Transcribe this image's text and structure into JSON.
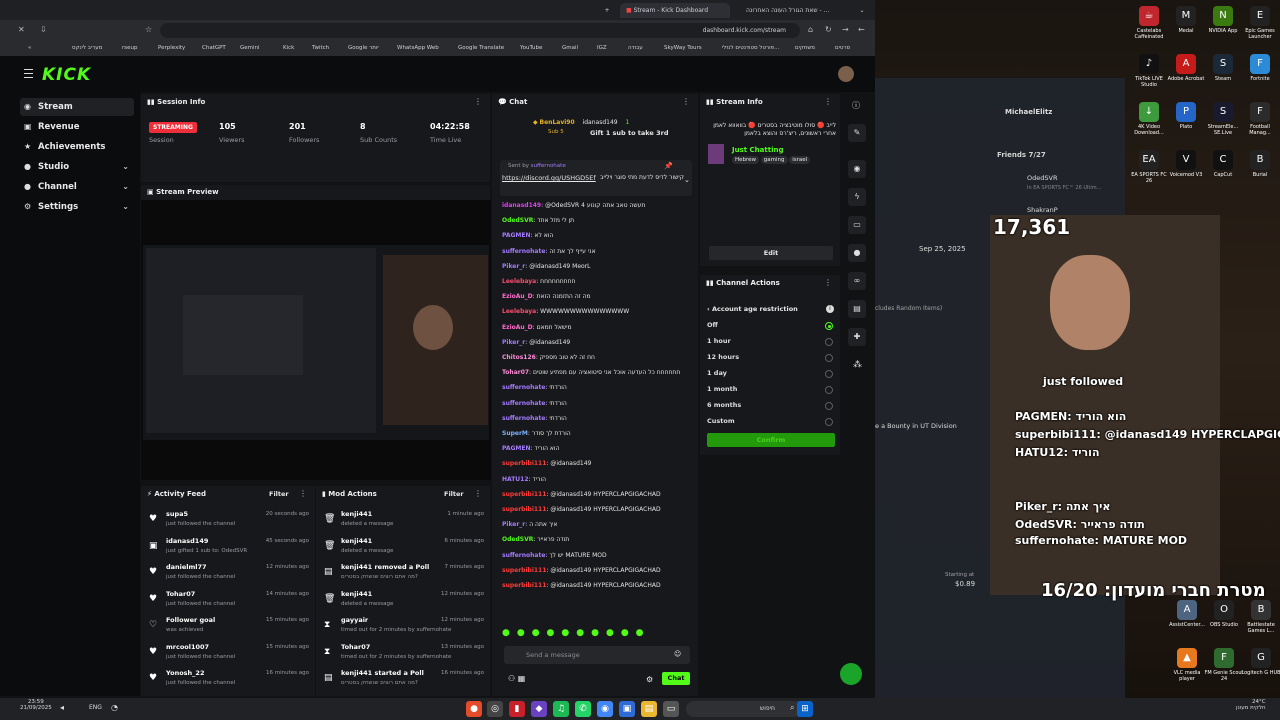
{
  "browser": {
    "tabs": [
      "Stream - Kick Dashboard",
      "שאת הגורל העונה האחרונה - ..."
    ],
    "url": "dashboard.kick.com/stream",
    "bookmarks": [
      "rseup",
      "Perplexity",
      "ChatGPT",
      "Gemini",
      "Kick",
      "Twitch",
      "Google יותר",
      "WhatsApp Web",
      "Google Translate",
      "YouTube",
      "Gmail",
      "IGZ",
      "עבודה",
      "SkyWay Tours",
      "פורטל סטודנטים לנזלי...",
      "משחקים",
      "סרטים"
    ],
    "bookmark_left": "מעריב לינקס"
  },
  "sidebar": {
    "items": [
      {
        "label": "Stream",
        "icon": "broadcast-icon",
        "active": true
      },
      {
        "label": "Revenue",
        "icon": "revenue-icon"
      },
      {
        "label": "Achievements",
        "icon": "achievements-icon"
      },
      {
        "label": "Studio",
        "icon": "studio-icon",
        "chev": "⌄"
      },
      {
        "label": "Channel",
        "icon": "channel-icon",
        "chev": "⌄"
      },
      {
        "label": "Settings",
        "icon": "settings-icon",
        "chev": "⌄"
      }
    ]
  },
  "session": {
    "title": "Session Info",
    "status": "STREAMING",
    "status_label": "Session",
    "stats": [
      {
        "value": "105",
        "label": "Viewers"
      },
      {
        "value": "201",
        "label": "Followers"
      },
      {
        "value": "8",
        "label": "Sub Counts"
      },
      {
        "value": "04:22:58",
        "label": "Time Live"
      }
    ]
  },
  "preview": {
    "title": "Stream Preview"
  },
  "activity": {
    "title": "Activity Feed",
    "filter": "Filter",
    "rows": [
      {
        "name": "supa5",
        "desc": "just followed the channel",
        "time": "20 seconds ago",
        "icon": "heart-icon"
      },
      {
        "name": "idanasd149",
        "desc": "just gifted 1 sub to: OdedSVR",
        "time": "45 seconds ago",
        "icon": "gift-icon"
      },
      {
        "name": "danielml77",
        "desc": "just followed the channel",
        "time": "12 minutes ago",
        "icon": "heart-icon"
      },
      {
        "name": "Tohar07",
        "desc": "just followed the channel",
        "time": "14 minutes ago",
        "icon": "heart-icon"
      },
      {
        "name": "Follower goal",
        "desc": "was achieved",
        "time": "15 minutes ago",
        "icon": "heart-outline-icon"
      },
      {
        "name": "mrcool1007",
        "desc": "just followed the channel",
        "time": "15 minutes ago",
        "icon": "heart-icon"
      },
      {
        "name": "Yonosh_22",
        "desc": "just followed the channel",
        "time": "16 minutes ago",
        "icon": "heart-icon"
      }
    ]
  },
  "mod": {
    "title": "Mod Actions",
    "filter": "Filter",
    "rows": [
      {
        "name": "kenji441",
        "desc": "deleted a message",
        "time": "1 minute ago",
        "icon": "trash-icon"
      },
      {
        "name": "kenji441",
        "desc": "deleted a message",
        "time": "6 minutes ago",
        "icon": "trash-icon"
      },
      {
        "name": "kenji441 removed a Poll",
        "desc": "מה אתם רוצים שנשחק בסטרים?",
        "time": "7 minutes ago",
        "icon": "poll-icon"
      },
      {
        "name": "kenji441",
        "desc": "deleted a message",
        "time": "12 minutes ago",
        "icon": "trash-icon"
      },
      {
        "name": "gayyair",
        "desc": "timed out for 2 minutes by suffernohate",
        "time": "12 minutes ago",
        "icon": "hourglass-icon"
      },
      {
        "name": "Tohar07",
        "desc": "timed out for 2 minutes by suffernohate",
        "time": "13 minutes ago",
        "icon": "hourglass-icon"
      },
      {
        "name": "kenji441 started a Poll",
        "desc": "מה אתם רוצים שנשחק בסטרים?",
        "time": "16 minutes ago",
        "icon": "poll-icon"
      }
    ]
  },
  "chat": {
    "title": "Chat",
    "gift_user": "BenLavi90",
    "gift_sub": "Sub 5",
    "gift_to": "idanasd149",
    "gift_count": "1",
    "gift_text": "Gift 1 sub to take 3rd",
    "pinned_by": "Sent by",
    "pinned_user": "suffernohate",
    "pinned_link": "https://discord.gg/USHGD5Ef",
    "pinned_text": "קישור לדיס לדעת מתי סוגר וילייב",
    "messages": [
      {
        "user": "idanasd149",
        "text": "@OdedSVR 4 תעשה טאב אתה קונוע",
        "color": "#e13ff2"
      },
      {
        "user": "OdedSVR",
        "text": "תן לי מזל אחד",
        "color": "#53fc18"
      },
      {
        "user": "PAGMEN",
        "text": "הוא לא",
        "color": "#a47cff"
      },
      {
        "user": "suffernohate",
        "text": "אני עייף לך את זה",
        "color": "#a47cff"
      },
      {
        "user": "Piker_r",
        "text": "@idanasd149 MeorL",
        "color": "#a47cff"
      },
      {
        "user": "Leelebaya",
        "text": "חחחחחחחחח",
        "color": "#ff4b6e"
      },
      {
        "user": "EzioAu_D",
        "text": "מה זה התזמנה הזאת",
        "color": "#ff6bcf"
      },
      {
        "user": "Leelebaya",
        "text": "WWWWWWWWWWWWWWW",
        "color": "#ff4b6e"
      },
      {
        "user": "EzioAu_D",
        "text": "מישאל חמאם",
        "color": "#ff6bcf"
      },
      {
        "user": "Piker_r",
        "text": "@idanasd149",
        "color": "#a47cff"
      },
      {
        "user": "Chitos126",
        "text": "חח זה לא טוב מספיק",
        "color": "#ff8ad8"
      },
      {
        "user": "Tohar07",
        "text": "חחחחחח כל העדעה אוכל אני סיטואציה עם מפתיע שוטים",
        "color": "#ff8ad8"
      },
      {
        "user": "suffernohate",
        "text": "הורדתי",
        "color": "#a47cff"
      },
      {
        "user": "suffernohate",
        "text": "הורדתי",
        "color": "#a47cff"
      },
      {
        "user": "suffernohate",
        "text": "הורדתי",
        "color": "#a47cff"
      },
      {
        "user": "SuperM",
        "text": "הורדת לך סודר",
        "color": "#7ab1ff"
      },
      {
        "user": "PAGMEN",
        "text": "הוא הוריד",
        "color": "#a47cff"
      },
      {
        "user": "superbibi111",
        "text": "@idanasd149",
        "color": "#ff3b3b"
      },
      {
        "user": "HATU12",
        "text": "הוריד",
        "color": "#a47cff"
      },
      {
        "user": "superbibi111",
        "text": "@idanasd149 HYPERCLAPGIGACHAD",
        "color": "#ff3b3b"
      },
      {
        "user": "superbibi111",
        "text": "@idanasd149 HYPERCLAPGIGACHAD",
        "color": "#ff3b3b"
      },
      {
        "user": "Piker_r",
        "text": "איך אתה ה",
        "color": "#a47cff"
      },
      {
        "user": "OdedSVR",
        "text": "תודה פראייר",
        "color": "#53fc18"
      },
      {
        "user": "suffernohate",
        "text": "יש לך MATURE MOD",
        "color": "#a47cff"
      },
      {
        "user": "superbibi111",
        "text": "@idanasd149 HYPERCLAPGIGACHAD",
        "color": "#ff3b3b"
      },
      {
        "user": "superbibi111",
        "text": "@idanasd149 HYPERCLAPGIGACHAD",
        "color": "#ff3b3b"
      }
    ],
    "input_placeholder": "Send a message",
    "send_label": "Chat"
  },
  "stream_info": {
    "title": "Stream Info",
    "stream_title": "לייב 🔴 סולו מוטיבציה בסטרים 🔴 בוואווא לאמן אחרי ראשונים, ריצ'רס והוצא בלאמן",
    "category": "Just Chatting",
    "tags": [
      "Hebrew",
      "gaming",
      "israel"
    ],
    "edit": "Edit"
  },
  "channel_actions": {
    "title": "Channel Actions",
    "back_label": "Account age restriction",
    "options": [
      "Off",
      "1 hour",
      "12 hours",
      "1 day",
      "1 month",
      "6 months",
      "Custom"
    ],
    "selected": 0,
    "confirm": "Confirm"
  },
  "desktop": {
    "icons": [
      {
        "label": "Castelabs Caffeinated",
        "color": "#c0262d",
        "glyph": "☕"
      },
      {
        "label": "Medal",
        "color": "#222",
        "glyph": "M"
      },
      {
        "label": "NVIDIA App",
        "color": "#3a7a10",
        "glyph": "N"
      },
      {
        "label": "Epic Games Launcher",
        "color": "#222",
        "glyph": "E"
      },
      {
        "label": "TikTok LIVE Studio",
        "color": "#111",
        "glyph": "♪"
      },
      {
        "label": "Adobe Acrobat",
        "color": "#c51b1b",
        "glyph": "A"
      },
      {
        "label": "Steam",
        "color": "#1b2838",
        "glyph": "S"
      },
      {
        "label": "Fortnite",
        "color": "#2b8bd6",
        "glyph": "F"
      },
      {
        "label": "4K Video Download...",
        "color": "#3d9b3d",
        "glyph": "↓"
      },
      {
        "label": "Plato",
        "color": "#2565c7",
        "glyph": "P"
      },
      {
        "label": "StreamEle... SE.Live",
        "color": "#1a1a2e",
        "glyph": "S"
      },
      {
        "label": "Football Manag...",
        "color": "#2b2b2b",
        "glyph": "F"
      },
      {
        "label": "EA SPORTS FC 26",
        "color": "#222",
        "glyph": "EA"
      },
      {
        "label": "Voicemod V3",
        "color": "#111",
        "glyph": "V"
      },
      {
        "label": "CapCut",
        "color": "#111",
        "glyph": "C"
      },
      {
        "label": "Burial",
        "color": "#222",
        "glyph": "B"
      }
    ],
    "icons_bottom": [
      {
        "label": "AssistCenter...",
        "color": "#4d6580",
        "glyph": "A"
      },
      {
        "label": "OBS Studio",
        "color": "#222",
        "glyph": "O"
      },
      {
        "label": "Battlestate Games L...",
        "color": "#333",
        "glyph": "B"
      },
      {
        "label": "VLC media player",
        "color": "#e8781e",
        "glyph": "▲"
      },
      {
        "label": "FM Genie Scout 24",
        "color": "#2f6b2f",
        "glyph": "F"
      },
      {
        "label": "Logitech G HUB",
        "color": "#222",
        "glyph": "G"
      }
    ],
    "overlays": [
      {
        "text": "17,361",
        "size": 20
      },
      {
        "text": "16/20 :מטרת חברי מועדון",
        "size": 18
      },
      {
        "text": "just followed"
      },
      {
        "text": "PAGMEN: הוא הוריד"
      },
      {
        "text": "superbibi111: @idanasd149 HYPERCLAPGIGACH"
      },
      {
        "text": "HATU12: הוריד"
      },
      {
        "text": "Piker_r: איך אתה"
      },
      {
        "text": "OdedSVR: תודה פראייר"
      },
      {
        "text": "suffernohate: MATURE MOD"
      }
    ],
    "friends_title": "Friends 7/27",
    "friend1": "MichaelElitz",
    "friend2": "OdedSVR",
    "friend2_sub": "In EA SPORTS FC™ 26 Ultim...",
    "friend3": "ShakranP",
    "date": "Sep 25, 2025",
    "bounty": "e a Bounty in UT Division",
    "starting": "Starting at",
    "price": "$0.89",
    "random_items": "cludes Random Items)"
  },
  "taskbar": {
    "time": "23:59",
    "date": "21/09/2025",
    "lang": "ENG",
    "weather": "24°C",
    "weather_desc": "חלקית מעונן",
    "search": "חיפוש"
  }
}
